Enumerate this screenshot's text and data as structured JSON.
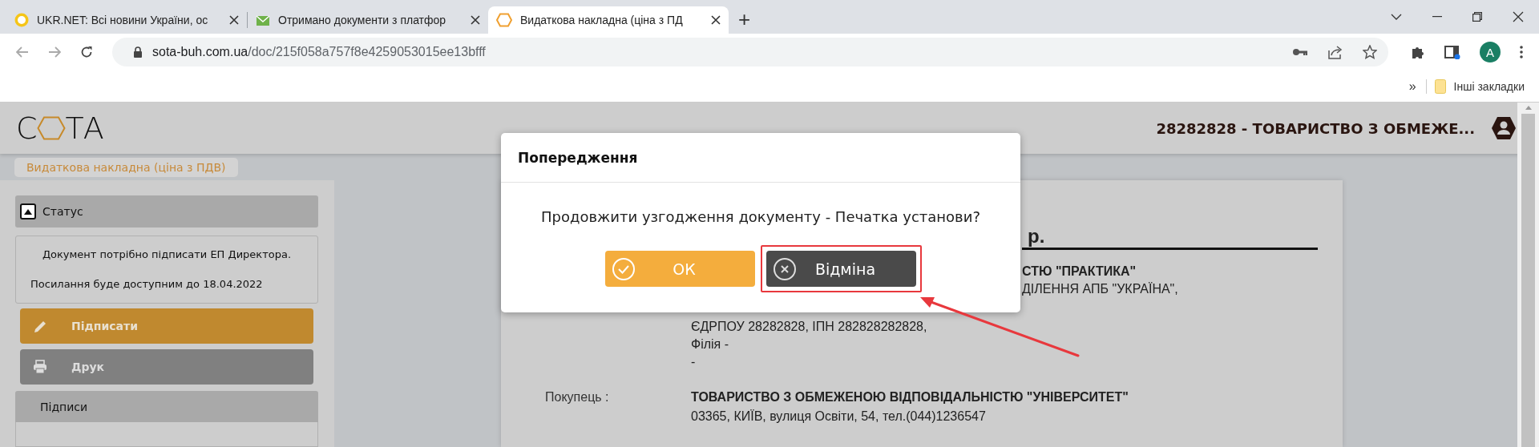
{
  "browser": {
    "tabs": [
      {
        "title": "UKR.NET: Всі новини України, ос",
        "kind": "ukrnet",
        "selected": false
      },
      {
        "title": "Отримано документи з платфор",
        "kind": "mail",
        "selected": false
      },
      {
        "title": "Видаткова накладна (ціна з ПД",
        "kind": "sota",
        "selected": true
      }
    ],
    "new_tab": "+",
    "address": {
      "host": "sota-buh.com.ua",
      "path": "/doc/215f058a757f8e4259053015ee13bfff"
    },
    "profile_initial": "A",
    "bookmarks": {
      "overflow": "»",
      "folder": "Інші закладки"
    }
  },
  "header": {
    "logo_left": "С",
    "logo_right": "ТА",
    "company": "28282828 - ТОВАРИСТВО З ОБМЕЖЕ..."
  },
  "document_tag": "Видаткова накладна (ціна з ПДВ)",
  "sidebar": {
    "status": {
      "title": "Статус",
      "expanded": true,
      "lines": [
        "Документ потрібно підписати ЕП Директора.",
        "Посилання буде доступним до 18.04.2022"
      ]
    },
    "actions": [
      {
        "label": "Підписати",
        "kind": "sign"
      },
      {
        "label": "Друк",
        "kind": "print"
      }
    ],
    "signatures": {
      "title": "Підписи"
    }
  },
  "document": {
    "title_fragment": "р.",
    "seller_fragments": [
      {
        "text": "СТЮ \"ПРАКТИКА\"",
        "bold": true
      },
      {
        "text": "ДІЛЕННЯ АПБ \"УКРАЇНА\",",
        "bold": false
      }
    ],
    "seller_lines": [
      "ЄДРПОУ 28282828, ІПН 282828282828,",
      "Філія -",
      "-"
    ],
    "buyer": {
      "label": "Покупець :",
      "name": "ТОВАРИСТВО З ОБМЕЖЕНОЮ ВІДПОВІДАЛЬНІСТЮ \"УНІВЕРСИТЕТ\"",
      "address": "03365, КИЇВ, вулиця Освіти, 54, тел.(044)1236547"
    }
  },
  "dialog": {
    "title": "Попередження",
    "message": "Продовжити узгодження документу - Печатка установи?",
    "buttons": [
      {
        "label": "ОК",
        "kind": "ok",
        "highlighted": false
      },
      {
        "label": "Відміна",
        "kind": "cancel",
        "highlighted": true
      }
    ]
  }
}
